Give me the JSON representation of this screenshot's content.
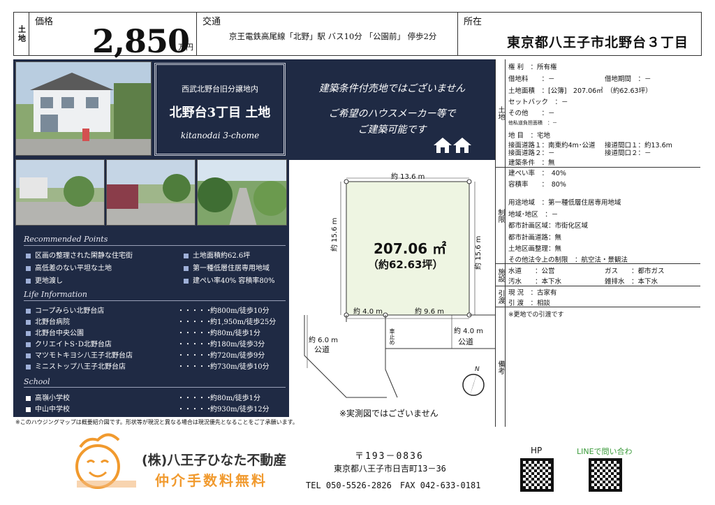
{
  "header": {
    "type": "土地",
    "price_label": "価格",
    "price": "2,850",
    "price_unit": "万円",
    "traffic_label": "交通",
    "traffic": "京王電鉄高尾線「北野」駅 バス10分 「公園前」 停歩2分",
    "location_label": "所在",
    "location": "東京都八王子市北野台３丁目"
  },
  "listing": {
    "subtitle": "西武北野台旧分譲地内",
    "title": "北野台3丁目 土地",
    "romaji": "kitanodai 3-chome"
  },
  "banner": {
    "line1": "建築条件付売地ではございません",
    "line2": "ご希望のハウスメーカー等で",
    "line3": "ご建築可能です"
  },
  "recommended": {
    "heading": "Recommended Points",
    "left": [
      "区画の整理された閑静な住宅街",
      "高低差のない平坦な土地",
      "更地渡し"
    ],
    "right": [
      "土地面積約62.6坪",
      "第一種低層住居専用地域",
      "建ぺい率40% 容積率80%"
    ]
  },
  "life": {
    "heading": "Life Information",
    "items": [
      {
        "name": "コープみらい北野台店",
        "dist": "約800m/徒歩10分"
      },
      {
        "name": "北野台病院",
        "dist": "約1,950m/徒歩25分"
      },
      {
        "name": "北野台中央公園",
        "dist": "約80m/徒歩1分"
      },
      {
        "name": "クリエイトS･D北野台店",
        "dist": "約180m/徒歩3分"
      },
      {
        "name": "マツモトキヨシ八王子北野台店",
        "dist": "約720m/徒歩9分"
      },
      {
        "name": "ミニストップ八王子北野台店",
        "dist": "約730m/徒歩10分"
      }
    ],
    "dots": "・・・・・"
  },
  "school": {
    "heading": "School",
    "items": [
      {
        "name": "高嶺小学校",
        "dist": "約80m/徒歩1分"
      },
      {
        "name": "中山中学校",
        "dist": "約930m/徒歩12分"
      }
    ]
  },
  "notice": "※このハウジングマップは概要紹介図です。形状等が現況と異なる場合は現況優先となることをご了承願います。",
  "plan": {
    "area_m2": "207.06 ㎡",
    "area_tsubo": "（約62.63坪）",
    "top": "約 13.6 m",
    "left": "約 15.6 m",
    "right": "約 15.6 m",
    "bottom_left": "約 4.0 m",
    "bottom_right": "約 9.6 m",
    "road_left_w": "約 6.0 m",
    "road_left": "公道",
    "road_right_w": "約 4.0 m",
    "road_right": "公道",
    "car_stop": "車止め",
    "north": "N",
    "disclaimer": "※実測図ではございません"
  },
  "table": {
    "land_label": "土地",
    "restrict_label": "制限",
    "facility_label": "施設",
    "handover_label": "引渡",
    "remarks_label": "備考",
    "rights": "権 利　：所有権",
    "lease_fee": "借地料　　：－",
    "lease_period": "借地期間　：－",
    "land_area": "土地面積　：[公簿]　207.06㎡　（約62.63坪）",
    "setback": "セットバック　：－",
    "other": "その他　　：－",
    "private_road": "他私道負担面積　：－",
    "category": "地 目　：宅地",
    "road1": "接面道路１：南東約4m･公道",
    "road1_front": "接道間口１：約13.6m",
    "road2": "接面道路２：－",
    "road2_front": "接道間口２：－",
    "build_cond": "建築条件　：無",
    "coverage": "建ぺい率　：　40%",
    "far": "容積率　　：　80%",
    "use_zone": "用途地域　：第一種低層住居専用地域",
    "district": "地域･地区　：－",
    "city_zone": "都市計画区域：市街化区域",
    "city_road": "都市計画道路：無",
    "readjust": "土地区画整理：無",
    "other_law": "その他法令上の制限　：航空法・景観法",
    "water": "水道　　：公営",
    "gas": "ガス　　：都市ガス",
    "sewer": "汚水　　：本下水",
    "drain": "雑排水　：本下水",
    "status": "現 況　：古家有",
    "handover": "引 渡　：相談",
    "remark": "※更地での引渡です"
  },
  "footer": {
    "company": "(株)八王子ひなた不動産",
    "slogan": "仲介手数料無料",
    "zip": "〒193－0836",
    "address": "東京都八王子市日吉町13－36",
    "contact": "TEL 050-5526-2826　FAX 042-633-0181",
    "hp": "HP",
    "line": "LINEで問い合わせ"
  },
  "colors": {
    "navy": "#1f2a44",
    "plot_green": "#eef5e2",
    "orange": "#f19a2e"
  }
}
